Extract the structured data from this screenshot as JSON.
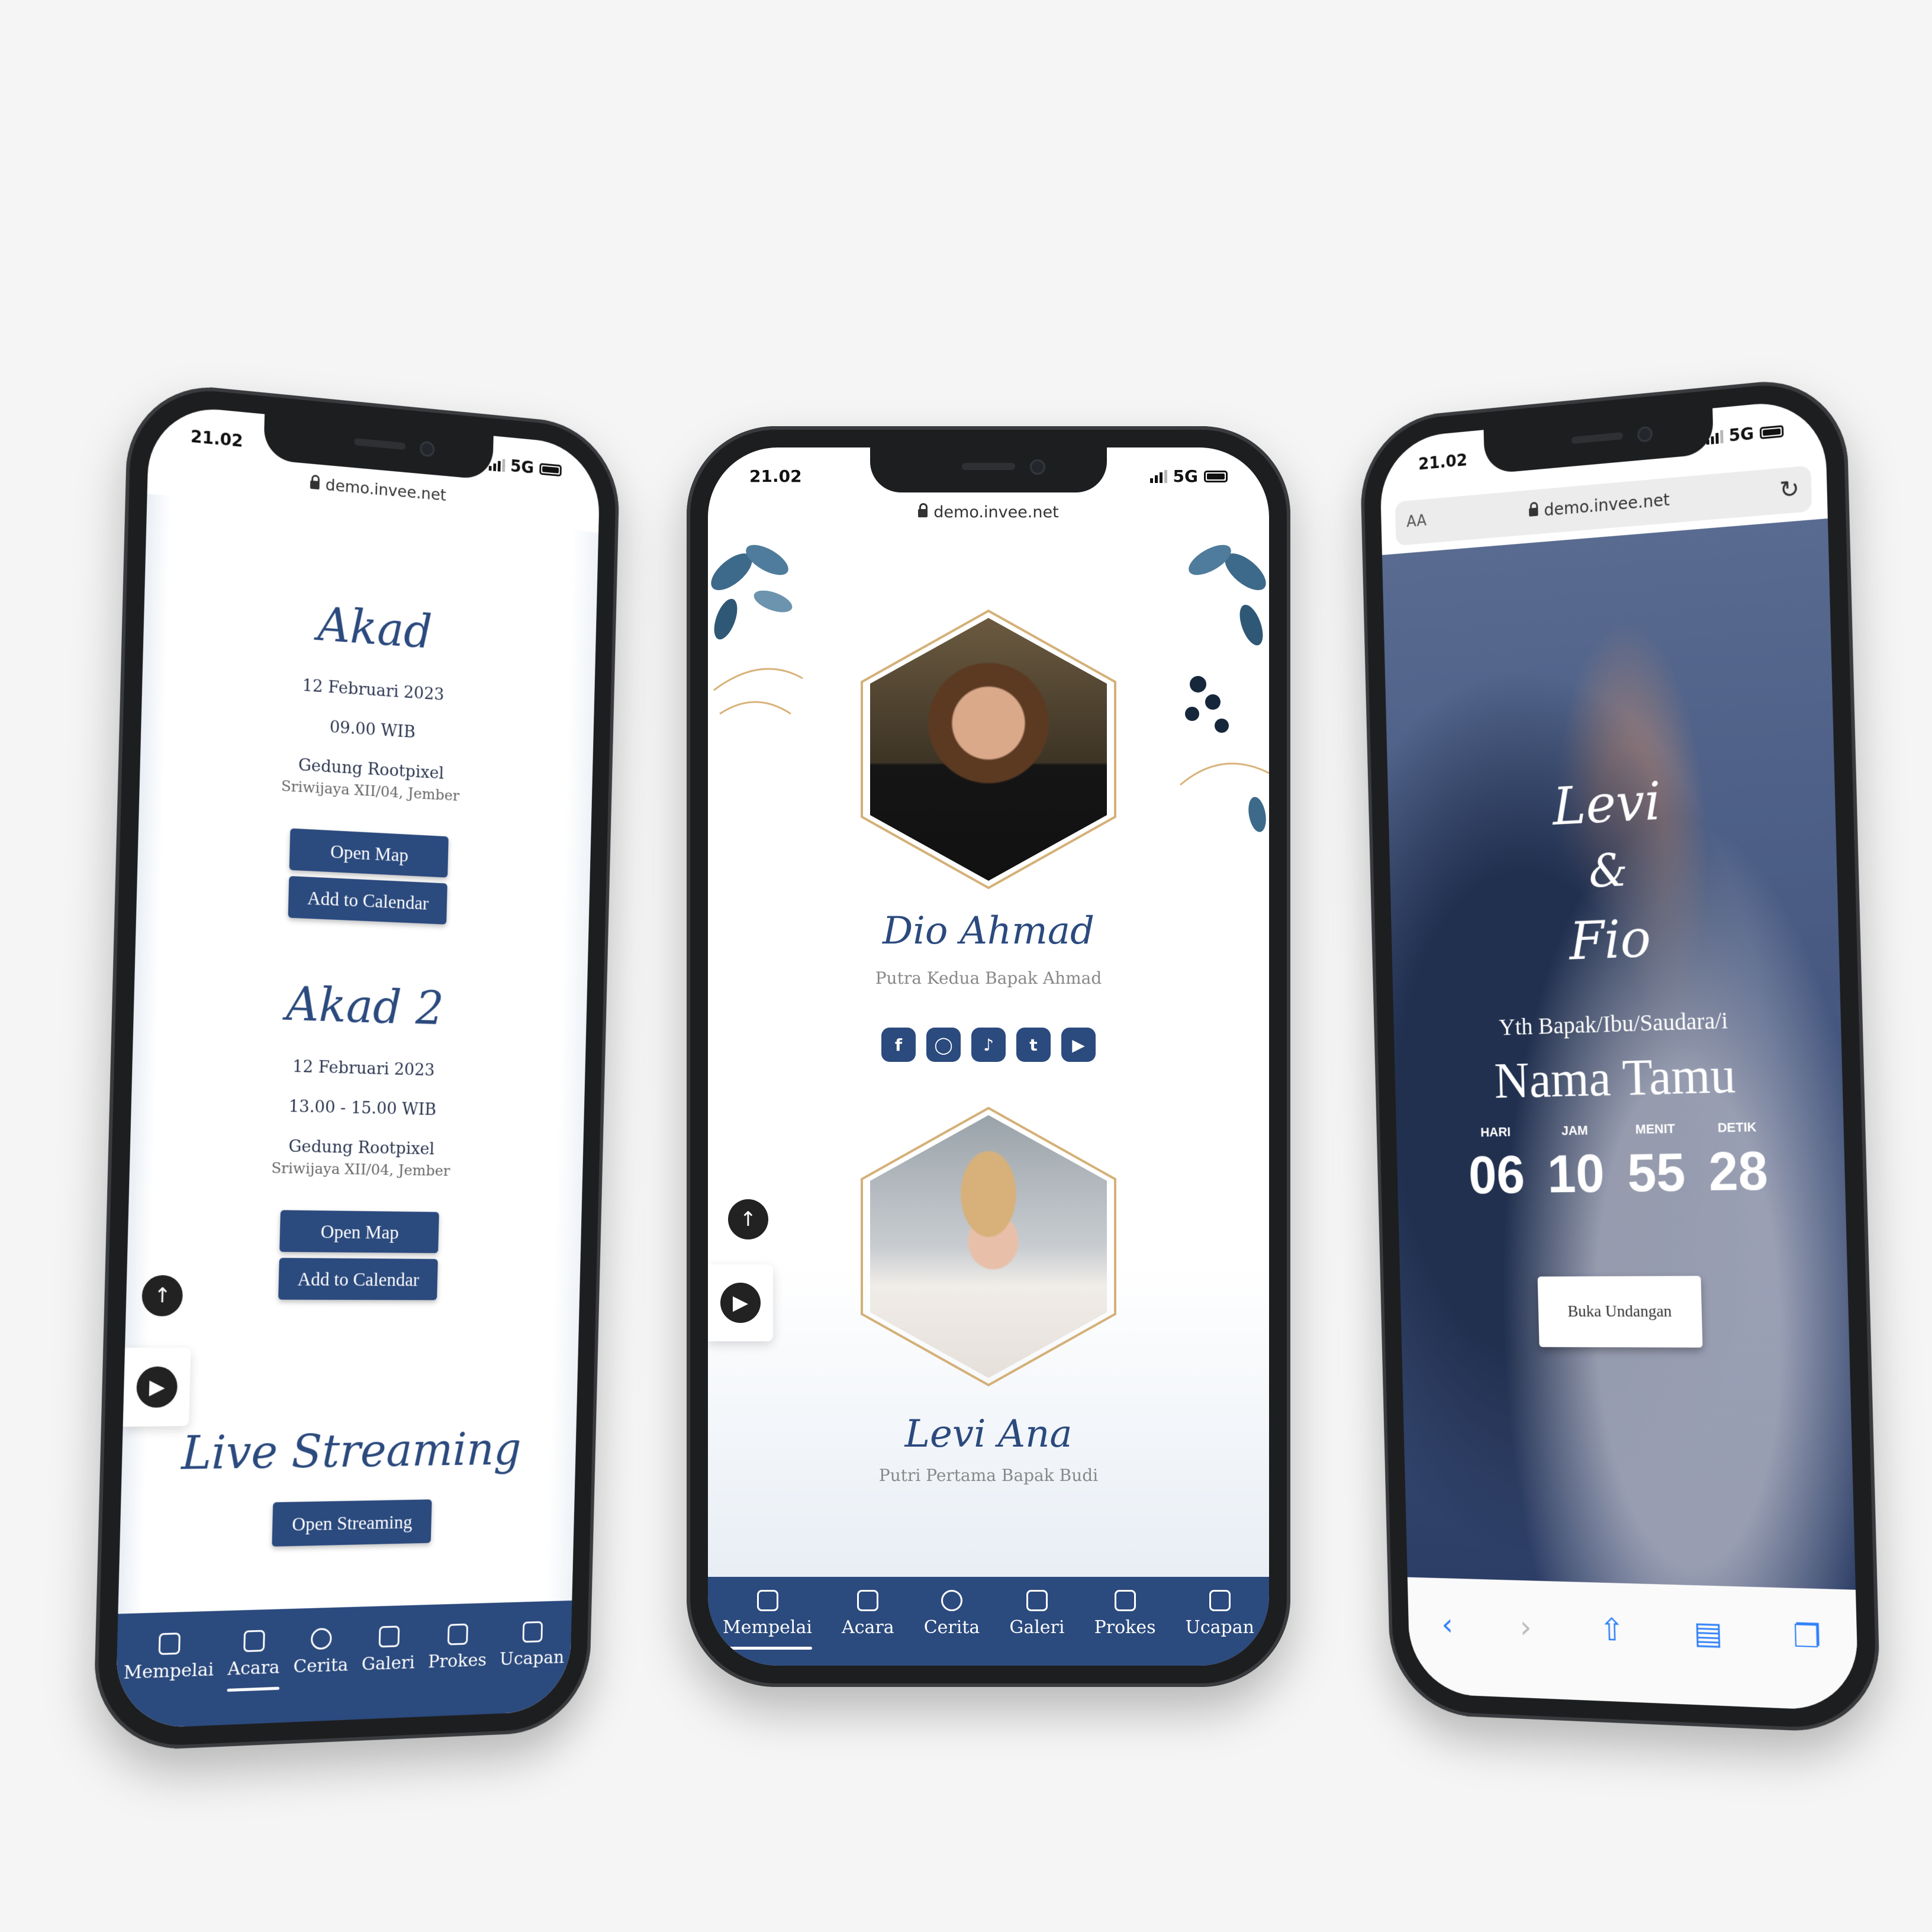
{
  "status": {
    "time": "21.02",
    "network": "5G"
  },
  "url": "demo.invee.net",
  "nav": [
    "Mempelai",
    "Acara",
    "Cerita",
    "Galeri",
    "Prokes",
    "Ucapan"
  ],
  "left": {
    "events": [
      {
        "title": "Akad",
        "date": "12 Februari 2023",
        "time": "09.00 WIB",
        "venue": "Gedung Rootpixel",
        "address": "Sriwijaya XII/04, Jember",
        "map": "Open Map",
        "calendar": "Add to Calendar"
      },
      {
        "title": "Akad 2",
        "date": "12 Februari 2023",
        "time": "13.00 - 15.00 WIB",
        "venue": "Gedung Rootpixel",
        "address": "Sriwijaya XII/04, Jember",
        "map": "Open Map",
        "calendar": "Add to Calendar"
      }
    ],
    "live_title": "Live Streaming",
    "live_button": "Open Streaming"
  },
  "middle": {
    "groom_name": "Dio Ahmad",
    "groom_parent": "Putra Kedua Bapak Ahmad",
    "bride_name": "Levi Ana",
    "bride_parent": "Putri Pertama Bapak Budi",
    "social_icons": [
      "facebook-icon",
      "instagram-icon",
      "tiktok-icon",
      "twitter-icon",
      "youtube-icon"
    ]
  },
  "right": {
    "aa": "AA",
    "couple_line1": "Levi",
    "couple_amp": "&",
    "couple_line2": "Fio",
    "greeting": "Yth Bapak/Ibu/Saudara/i",
    "guest_name": "Nama Tamu",
    "countdown_labels": [
      "HARI",
      "JAM",
      "MENIT",
      "DETIK"
    ],
    "countdown_values": [
      "06",
      "10",
      "55",
      "28"
    ],
    "open_button": "Buka Undangan"
  },
  "colors": {
    "primary": "#2b4a7e",
    "background": "#f4f5f4",
    "phone": "#1d1e20"
  }
}
